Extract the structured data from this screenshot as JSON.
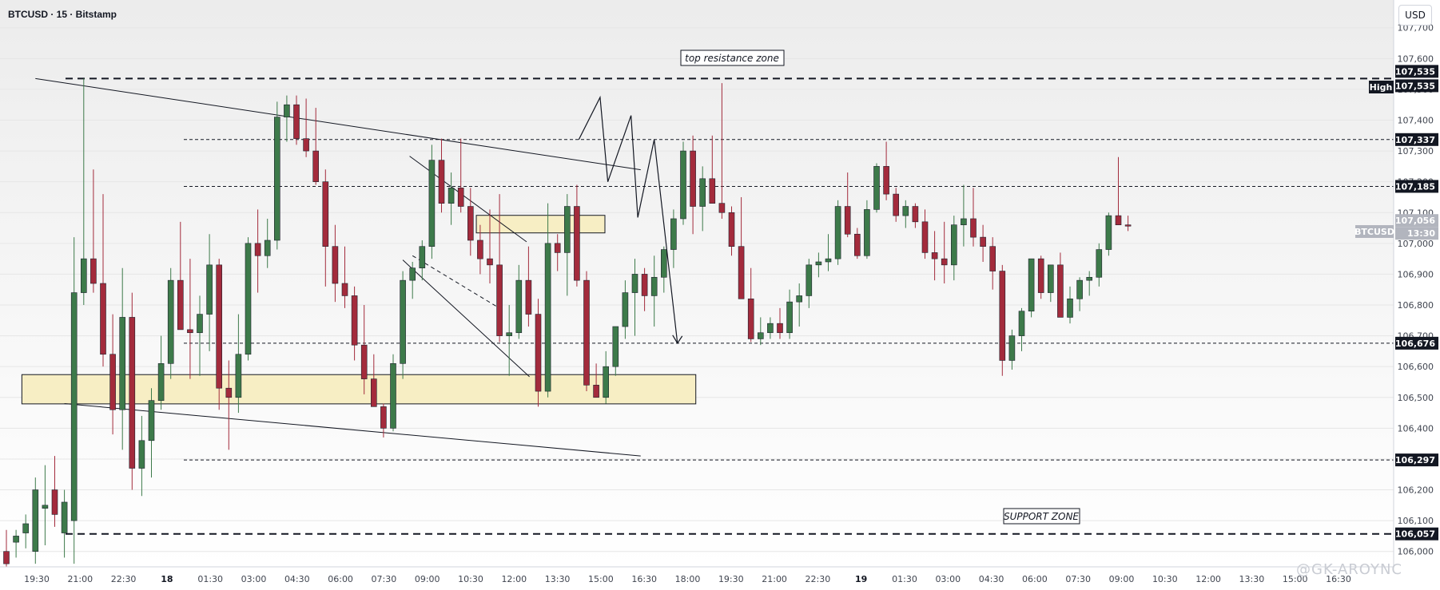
{
  "symbol_title": "BTCUSD · 15 · Bitstamp",
  "currency_button": "USD",
  "watermark": "@GK-AROYNC",
  "high_label": "High",
  "symbol_tag": "BTCUSD",
  "countdown": "13:30",
  "annotations": {
    "top_zone": "top resistance zone",
    "support_zone": "SUPPORT ZONE"
  },
  "colors": {
    "up": "#3d7a4a",
    "down": "#a32b3c",
    "zone_fill": "#f7eec4",
    "label_bg": "#131722",
    "symbol_tag_bg": "#b2b5be"
  },
  "chart_data": {
    "type": "candlestick",
    "title": "BTCUSD · 15 · Bitstamp",
    "price_axis": {
      "min": 105950,
      "max": 107790,
      "ticks": [
        106000,
        106100,
        106200,
        106300,
        106400,
        106500,
        106600,
        106700,
        106800,
        106900,
        107000,
        107100,
        107200,
        107300,
        107400,
        107500,
        107600,
        107700
      ]
    },
    "time_axis": {
      "ticks": [
        "19:30",
        "21:00",
        "22:30",
        "18",
        "01:30",
        "03:00",
        "04:30",
        "06:00",
        "07:30",
        "09:00",
        "10:30",
        "12:00",
        "13:30",
        "15:00",
        "16:30",
        "18:00",
        "19:30",
        "21:00",
        "22:30",
        "19",
        "01:30",
        "03:00",
        "04:30",
        "06:00",
        "07:30",
        "09:00",
        "10:30",
        "12:00",
        "13:30",
        "15:00",
        "16:30"
      ],
      "bold": [
        "18",
        "19"
      ]
    },
    "price_labels": [
      "107,535",
      "107,535",
      "107,337",
      "107,185",
      "107,056",
      "106,676",
      "106,297",
      "106,057"
    ],
    "last_price": 107056,
    "levels": [
      {
        "price": 107535,
        "style": "dash-bold"
      },
      {
        "price": 107337,
        "style": "dash"
      },
      {
        "price": 107185,
        "style": "dash"
      },
      {
        "price": 106676,
        "style": "dash"
      },
      {
        "price": 106297,
        "style": "dash"
      },
      {
        "price": 106057,
        "style": "dash-bold"
      }
    ],
    "zones": [
      {
        "from": 106479,
        "to": 106574,
        "t_start": 1.6,
        "t_end": 71.3
      },
      {
        "from": 107034,
        "to": 107091,
        "t_start": 48.6,
        "t_end": 61.9
      }
    ],
    "trendlines": [
      {
        "points": [
          [
            3.0,
            107535
          ],
          [
            65.6,
            107239
          ]
        ]
      },
      {
        "points": [
          [
            6.0,
            106480
          ],
          [
            65.6,
            106310
          ]
        ]
      },
      {
        "points": [
          [
            41.7,
            107283
          ],
          [
            53.8,
            107005
          ]
        ]
      },
      {
        "points": [
          [
            41.0,
            106946
          ],
          [
            54.1,
            106567
          ]
        ]
      },
      {
        "points": [
          [
            42.0,
            106960
          ],
          [
            51.5,
            106780
          ]
        ],
        "dashed": true
      }
    ],
    "projection": [
      [
        59.2,
        107337
      ],
      [
        61.4,
        107474
      ],
      [
        62.2,
        107200
      ],
      [
        64.6,
        107415
      ],
      [
        65.3,
        107084
      ],
      [
        67.0,
        107337
      ],
      [
        69.4,
        106676
      ]
    ],
    "candles": [
      {
        "o": 106000,
        "h": 106070,
        "l": 105940,
        "c": 105960
      },
      {
        "o": 106030,
        "h": 106070,
        "l": 105980,
        "c": 106050
      },
      {
        "o": 106060,
        "h": 106120,
        "l": 106010,
        "c": 106090
      },
      {
        "o": 106000,
        "h": 106240,
        "l": 105960,
        "c": 106200
      },
      {
        "o": 106140,
        "h": 106280,
        "l": 106020,
        "c": 106150
      },
      {
        "o": 106200,
        "h": 106310,
        "l": 106080,
        "c": 106120
      },
      {
        "o": 106060,
        "h": 106200,
        "l": 105980,
        "c": 106160
      },
      {
        "o": 106100,
        "h": 107020,
        "l": 105960,
        "c": 106840
      },
      {
        "o": 106840,
        "h": 107535,
        "l": 106800,
        "c": 106950
      },
      {
        "o": 106950,
        "h": 107240,
        "l": 106840,
        "c": 106870
      },
      {
        "o": 106870,
        "h": 107160,
        "l": 106600,
        "c": 106640
      },
      {
        "o": 106640,
        "h": 106770,
        "l": 106380,
        "c": 106460
      },
      {
        "o": 106460,
        "h": 106920,
        "l": 106330,
        "c": 106760
      },
      {
        "o": 106760,
        "h": 106840,
        "l": 106200,
        "c": 106270
      },
      {
        "o": 106270,
        "h": 106440,
        "l": 106180,
        "c": 106360
      },
      {
        "o": 106360,
        "h": 106530,
        "l": 106240,
        "c": 106490
      },
      {
        "o": 106490,
        "h": 106700,
        "l": 106460,
        "c": 106610
      },
      {
        "o": 106610,
        "h": 106920,
        "l": 106560,
        "c": 106880
      },
      {
        "o": 106880,
        "h": 107070,
        "l": 106730,
        "c": 106720
      },
      {
        "o": 106720,
        "h": 106950,
        "l": 106560,
        "c": 106710
      },
      {
        "o": 106710,
        "h": 106830,
        "l": 106570,
        "c": 106770
      },
      {
        "o": 106770,
        "h": 107030,
        "l": 106650,
        "c": 106930
      },
      {
        "o": 106930,
        "h": 106950,
        "l": 106460,
        "c": 106530
      },
      {
        "o": 106530,
        "h": 106620,
        "l": 106330,
        "c": 106500
      },
      {
        "o": 106500,
        "h": 106770,
        "l": 106450,
        "c": 106640
      },
      {
        "o": 106640,
        "h": 107020,
        "l": 106620,
        "c": 107000
      },
      {
        "o": 107000,
        "h": 107110,
        "l": 106840,
        "c": 106960
      },
      {
        "o": 106960,
        "h": 107080,
        "l": 106920,
        "c": 107010
      },
      {
        "o": 107010,
        "h": 107460,
        "l": 106980,
        "c": 107410
      },
      {
        "o": 107410,
        "h": 107480,
        "l": 107330,
        "c": 107450
      },
      {
        "o": 107450,
        "h": 107480,
        "l": 107320,
        "c": 107340
      },
      {
        "o": 107340,
        "h": 107470,
        "l": 107280,
        "c": 107300
      },
      {
        "o": 107300,
        "h": 107440,
        "l": 107190,
        "c": 107200
      },
      {
        "o": 107200,
        "h": 107240,
        "l": 106860,
        "c": 106990
      },
      {
        "o": 106990,
        "h": 107060,
        "l": 106810,
        "c": 106870
      },
      {
        "o": 106870,
        "h": 106990,
        "l": 106790,
        "c": 106830
      },
      {
        "o": 106830,
        "h": 106860,
        "l": 106620,
        "c": 106670
      },
      {
        "o": 106670,
        "h": 106800,
        "l": 106510,
        "c": 106560
      },
      {
        "o": 106560,
        "h": 106640,
        "l": 106470,
        "c": 106470
      },
      {
        "o": 106470,
        "h": 106480,
        "l": 106370,
        "c": 106400
      },
      {
        "o": 106400,
        "h": 106640,
        "l": 106390,
        "c": 106610
      },
      {
        "o": 106610,
        "h": 106910,
        "l": 106560,
        "c": 106880
      },
      {
        "o": 106880,
        "h": 106940,
        "l": 106820,
        "c": 106920
      },
      {
        "o": 106920,
        "h": 107010,
        "l": 106880,
        "c": 106990
      },
      {
        "o": 106990,
        "h": 107320,
        "l": 106950,
        "c": 107270
      },
      {
        "o": 107270,
        "h": 107340,
        "l": 107100,
        "c": 107130
      },
      {
        "o": 107130,
        "h": 107230,
        "l": 107060,
        "c": 107180
      },
      {
        "o": 107180,
        "h": 107340,
        "l": 107100,
        "c": 107120
      },
      {
        "o": 107120,
        "h": 107180,
        "l": 106960,
        "c": 107010
      },
      {
        "o": 107010,
        "h": 107060,
        "l": 106900,
        "c": 106950
      },
      {
        "o": 106950,
        "h": 107110,
        "l": 106870,
        "c": 106930
      },
      {
        "o": 106930,
        "h": 107160,
        "l": 106680,
        "c": 106700
      },
      {
        "o": 106700,
        "h": 106800,
        "l": 106570,
        "c": 106710
      },
      {
        "o": 106710,
        "h": 106930,
        "l": 106690,
        "c": 106880
      },
      {
        "o": 106880,
        "h": 106990,
        "l": 106730,
        "c": 106770
      },
      {
        "o": 106770,
        "h": 106820,
        "l": 106470,
        "c": 106520
      },
      {
        "o": 106520,
        "h": 107130,
        "l": 106500,
        "c": 107000
      },
      {
        "o": 107000,
        "h": 107030,
        "l": 106910,
        "c": 106970
      },
      {
        "o": 106970,
        "h": 107160,
        "l": 106830,
        "c": 107120
      },
      {
        "o": 107120,
        "h": 107190,
        "l": 106860,
        "c": 106880
      },
      {
        "o": 106880,
        "h": 106910,
        "l": 106520,
        "c": 106540
      },
      {
        "o": 106540,
        "h": 106610,
        "l": 106500,
        "c": 106500
      },
      {
        "o": 106500,
        "h": 106650,
        "l": 106480,
        "c": 106600
      },
      {
        "o": 106600,
        "h": 106730,
        "l": 106570,
        "c": 106730
      },
      {
        "o": 106730,
        "h": 106880,
        "l": 106690,
        "c": 106840
      },
      {
        "o": 106840,
        "h": 106950,
        "l": 106700,
        "c": 106900
      },
      {
        "o": 106900,
        "h": 106920,
        "l": 106780,
        "c": 106830
      },
      {
        "o": 106830,
        "h": 106960,
        "l": 106730,
        "c": 106890
      },
      {
        "o": 106890,
        "h": 106990,
        "l": 106840,
        "c": 106980
      },
      {
        "o": 106980,
        "h": 107110,
        "l": 106920,
        "c": 107080
      },
      {
        "o": 107080,
        "h": 107330,
        "l": 107060,
        "c": 107300
      },
      {
        "o": 107300,
        "h": 107350,
        "l": 107030,
        "c": 107120
      },
      {
        "o": 107120,
        "h": 107250,
        "l": 107040,
        "c": 107210
      },
      {
        "o": 107210,
        "h": 107350,
        "l": 107160,
        "c": 107130
      },
      {
        "o": 107130,
        "h": 107520,
        "l": 107080,
        "c": 107100
      },
      {
        "o": 107100,
        "h": 107120,
        "l": 106960,
        "c": 106990
      },
      {
        "o": 106990,
        "h": 107150,
        "l": 106820,
        "c": 106820
      },
      {
        "o": 106820,
        "h": 106920,
        "l": 106680,
        "c": 106690
      },
      {
        "o": 106690,
        "h": 106760,
        "l": 106670,
        "c": 106710
      },
      {
        "o": 106710,
        "h": 106760,
        "l": 106690,
        "c": 106740
      },
      {
        "o": 106740,
        "h": 106790,
        "l": 106690,
        "c": 106710
      },
      {
        "o": 106710,
        "h": 106850,
        "l": 106690,
        "c": 106810
      },
      {
        "o": 106810,
        "h": 106870,
        "l": 106730,
        "c": 106830
      },
      {
        "o": 106830,
        "h": 106950,
        "l": 106790,
        "c": 106930
      },
      {
        "o": 106930,
        "h": 106970,
        "l": 106890,
        "c": 106940
      },
      {
        "o": 106940,
        "h": 107030,
        "l": 106910,
        "c": 106950
      },
      {
        "o": 106950,
        "h": 107140,
        "l": 106930,
        "c": 107120
      },
      {
        "o": 107120,
        "h": 107230,
        "l": 107020,
        "c": 107030
      },
      {
        "o": 107030,
        "h": 107050,
        "l": 106950,
        "c": 106960
      },
      {
        "o": 106960,
        "h": 107140,
        "l": 106950,
        "c": 107110
      },
      {
        "o": 107110,
        "h": 107260,
        "l": 107100,
        "c": 107250
      },
      {
        "o": 107250,
        "h": 107330,
        "l": 107140,
        "c": 107160
      },
      {
        "o": 107160,
        "h": 107180,
        "l": 107070,
        "c": 107090
      },
      {
        "o": 107090,
        "h": 107140,
        "l": 107050,
        "c": 107120
      },
      {
        "o": 107120,
        "h": 107130,
        "l": 107050,
        "c": 107070
      },
      {
        "o": 107070,
        "h": 107110,
        "l": 106950,
        "c": 106970
      },
      {
        "o": 106970,
        "h": 107040,
        "l": 106880,
        "c": 106950
      },
      {
        "o": 106950,
        "h": 107070,
        "l": 106870,
        "c": 106930
      },
      {
        "o": 106930,
        "h": 107090,
        "l": 106880,
        "c": 107060
      },
      {
        "o": 107060,
        "h": 107190,
        "l": 106990,
        "c": 107080
      },
      {
        "o": 107080,
        "h": 107180,
        "l": 106990,
        "c": 107020
      },
      {
        "o": 107020,
        "h": 107060,
        "l": 106940,
        "c": 106990
      },
      {
        "o": 106990,
        "h": 107020,
        "l": 106850,
        "c": 106910
      },
      {
        "o": 106910,
        "h": 106930,
        "l": 106570,
        "c": 106620
      },
      {
        "o": 106620,
        "h": 106720,
        "l": 106590,
        "c": 106700
      },
      {
        "o": 106700,
        "h": 106790,
        "l": 106650,
        "c": 106780
      },
      {
        "o": 106780,
        "h": 106950,
        "l": 106760,
        "c": 106950
      },
      {
        "o": 106950,
        "h": 106960,
        "l": 106820,
        "c": 106840
      },
      {
        "o": 106840,
        "h": 106930,
        "l": 106810,
        "c": 106930
      },
      {
        "o": 106930,
        "h": 106970,
        "l": 106820,
        "c": 106760
      },
      {
        "o": 106760,
        "h": 106860,
        "l": 106740,
        "c": 106820
      },
      {
        "o": 106820,
        "h": 106890,
        "l": 106780,
        "c": 106880
      },
      {
        "o": 106880,
        "h": 106910,
        "l": 106830,
        "c": 106890
      },
      {
        "o": 106890,
        "h": 107000,
        "l": 106860,
        "c": 106980
      },
      {
        "o": 106980,
        "h": 107100,
        "l": 106960,
        "c": 107090
      },
      {
        "o": 107090,
        "h": 107280,
        "l": 107060,
        "c": 107060
      },
      {
        "o": 107060,
        "h": 107090,
        "l": 107040,
        "c": 107056
      }
    ]
  }
}
